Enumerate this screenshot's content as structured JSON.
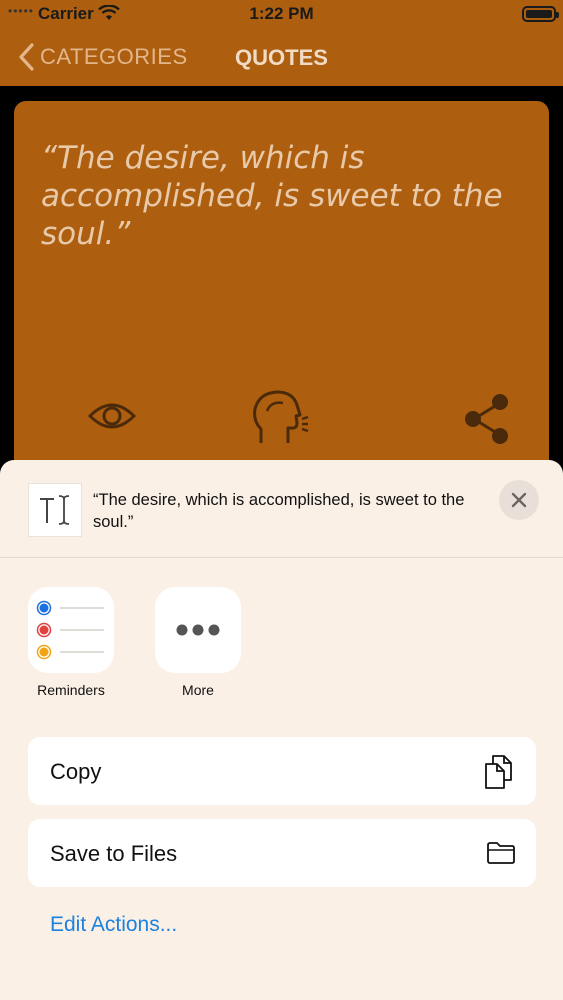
{
  "status_bar": {
    "carrier": "Carrier",
    "time": "1:22 PM"
  },
  "nav": {
    "back_label": "CATEGORIES",
    "title": "QUOTES"
  },
  "quote_card": {
    "text": "“The desire, which is accomplished, is sweet to the soul.”",
    "icons": [
      "eye-icon",
      "speaking-head-icon",
      "share-icon"
    ]
  },
  "share_sheet": {
    "preview_text": "“The desire, which is accomplished, is sweet to the soul.”",
    "apps": [
      {
        "label": "Reminders",
        "icon": "reminders-icon"
      },
      {
        "label": "More",
        "icon": "more-icon"
      }
    ],
    "actions": [
      {
        "label": "Copy",
        "icon": "copy-icon"
      },
      {
        "label": "Save to Files",
        "icon": "folder-icon"
      }
    ],
    "edit_actions_label": "Edit Actions..."
  },
  "colors": {
    "accent": "#ad5f0f",
    "link": "#1b82e0",
    "sheet_bg": "#fbf0e6"
  }
}
